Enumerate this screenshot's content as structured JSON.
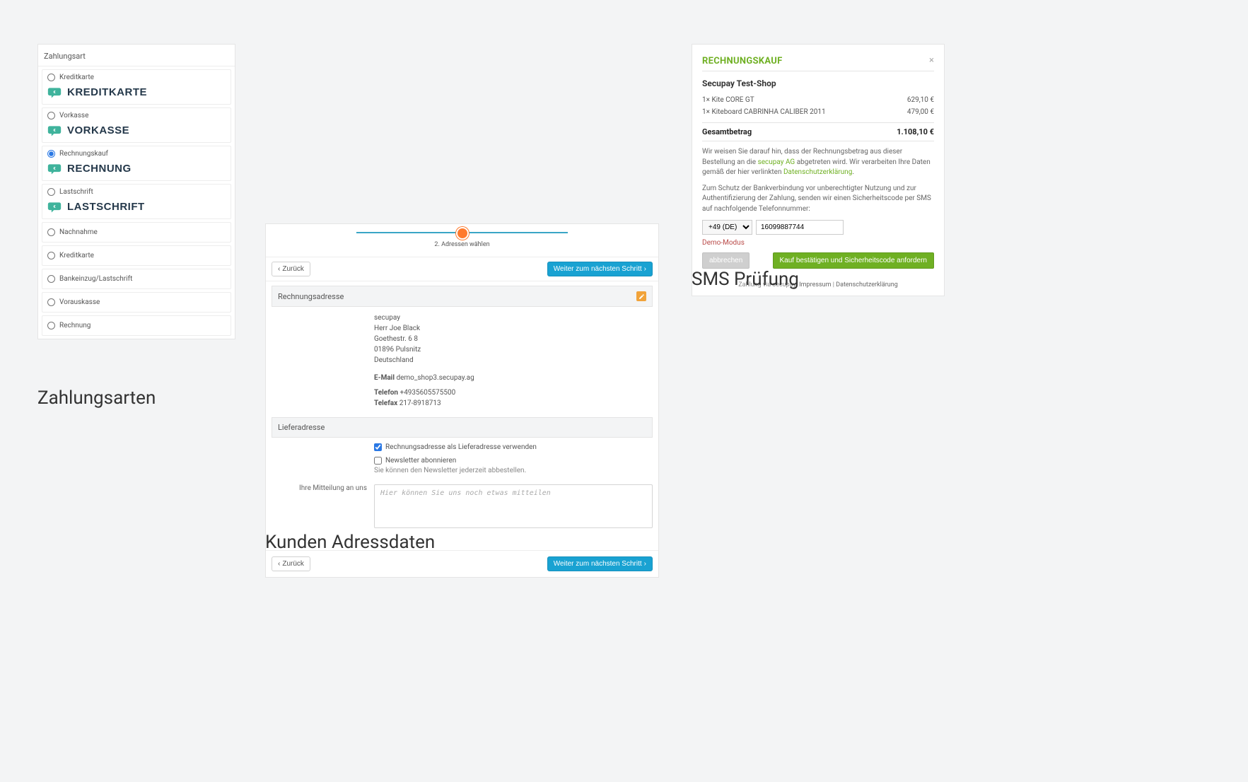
{
  "captions": {
    "zahlungsarten": "Zahlungsarten",
    "adressdaten": "Kunden Adressdaten",
    "sms": "SMS Prüfung"
  },
  "p1": {
    "section_title": "Zahlungsart",
    "options": [
      {
        "label": "Kreditkarte",
        "brand": "KREDITKARTE",
        "checked": false
      },
      {
        "label": "Vorkasse",
        "brand": "VORKASSE",
        "checked": false
      },
      {
        "label": "Rechnungskauf",
        "brand": "RECHNUNG",
        "checked": true
      },
      {
        "label": "Lastschrift",
        "brand": "LASTSCHRIFT",
        "checked": false
      },
      {
        "label": "Nachnahme",
        "brand": "",
        "checked": false
      },
      {
        "label": "Kreditkarte",
        "brand": "",
        "checked": false
      },
      {
        "label": "Bankeinzug/Lastschrift",
        "brand": "",
        "checked": false
      },
      {
        "label": "Vorauskasse",
        "brand": "",
        "checked": false
      },
      {
        "label": "Rechnung",
        "brand": "",
        "checked": false
      }
    ]
  },
  "p2": {
    "step_label": "2. Adressen wählen",
    "back": "Zurück",
    "next": "Weiter zum nächsten Schritt",
    "billing_title": "Rechnungsadresse",
    "billing": {
      "company": "secupay",
      "name": "Herr Joe Black",
      "street": "Goethestr. 6 8",
      "zip_city": "01896 Pulsnitz",
      "country": "Deutschland",
      "email_label": "E-Mail",
      "email": "demo_shop3.secupay.ag",
      "phone_label": "Telefon",
      "phone": "+4935605575500",
      "fax_label": "Telefax",
      "fax": "217-8918713"
    },
    "shipping_title": "Lieferadresse",
    "use_billing_label": "Rechnungsadresse als Lieferadresse verwenden",
    "use_billing_checked": true,
    "newsletter_label": "Newsletter abonnieren",
    "newsletter_checked": false,
    "newsletter_help": "Sie können den Newsletter jederzeit abbestellen.",
    "message_label": "Ihre Mitteilung an uns",
    "message_placeholder": "Hier können Sie uns noch etwas mitteilen"
  },
  "p3": {
    "title": "RECHNUNGSKAUF",
    "shop": "Secupay Test-Shop",
    "items": [
      {
        "label": "1× Kite CORE GT",
        "price": "629,10 €"
      },
      {
        "label": "1× Kiteboard CABRINHA CALIBER 2011",
        "price": "479,00 €"
      }
    ],
    "total_label": "Gesamtbetrag",
    "total_value": "1.108,10 €",
    "note1_a": "Wir weisen Sie darauf hin, dass der Rechnungsbetrag aus dieser Bestellung an die ",
    "note1_link1": "secupay AG",
    "note1_b": " abgetreten wird. Wir verarbeiten Ihre Daten gemäß der hier verlinkten ",
    "note1_link2": "Datenschutzerklärung",
    "note1_c": ".",
    "note2": "Zum Schutz der Bankverbindung vor unberechtigter Nutzung und zur Authentifizierung der Zahlung, senden wir einen Sicherheitscode per SMS auf nachfolgende Telefonnummer:",
    "dial_code": "+49 (DE)",
    "phone_value": "16099887744",
    "demo": "Demo-Modus",
    "cancel": "abbrechen",
    "confirm": "Kauf bestätigen und Sicherheitscode anfordern",
    "footer_a": "Zahlung via secupay: ",
    "footer_link1": "Impressum",
    "footer_sep": " | ",
    "footer_link2": "Datenschutzerklärung"
  }
}
